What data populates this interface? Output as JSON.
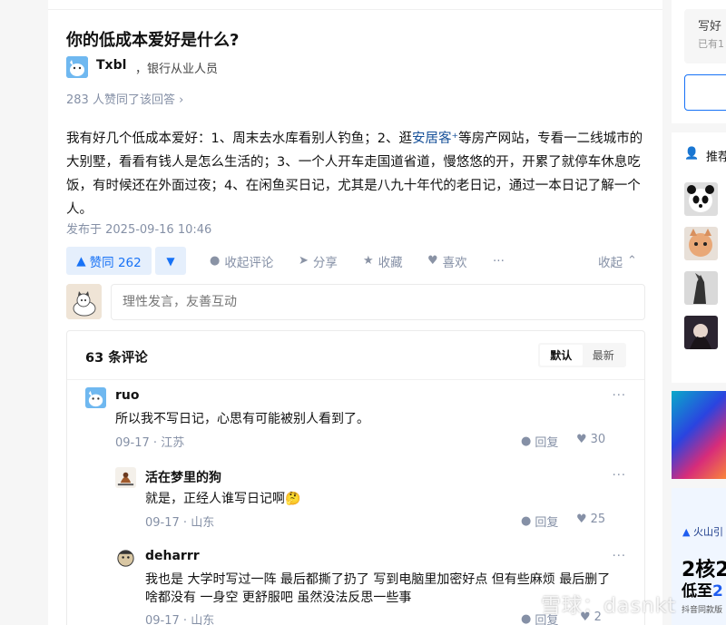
{
  "question": {
    "title": "你的低成本爱好是什么?"
  },
  "answer": {
    "author_name": "Txbl",
    "author_bio": "，银行从业人员",
    "upvote_summary": "283 人赞同了该回答 ›",
    "body_before_link": "我有好几个低成本爱好：1、周末去水库看别人钓鱼；2、逛",
    "body_link": "安居客",
    "body_after_link": "等房产网站，专看一二线城市的大别墅，看看有钱人是怎么生活的；3、一个人开车走国道省道，慢悠悠的开，开累了就停车休息吃饭，有时候还在外面过夜；4、在闲鱼买日记，尤其是八九十年代的老日记，通过一本日记了解一个人。",
    "post_time": "发布于 2025-09-16 10:46"
  },
  "actions": {
    "upvote_label": "赞同 262",
    "downvote_icon": "▼",
    "comment_label": "收起评论",
    "share_label": "分享",
    "favorite_label": "收藏",
    "like_label": "喜欢",
    "more_label": "···",
    "collapse_label": "收起"
  },
  "comment_input": {
    "placeholder": "理性发言，友善互动"
  },
  "comments": {
    "count_label": "63 条评论",
    "sort_tabs": [
      "默认",
      "最新"
    ],
    "items": [
      {
        "name": "ruo",
        "text": "所以我不写日记，心思有可能被别人看到了。",
        "date": "09-17",
        "location": "江苏",
        "reply_label": "回复",
        "likes": "30"
      },
      {
        "name": "活在梦里的狗",
        "text": "就是，正经人谁写日记啊🤔",
        "date": "09-17",
        "location": "山东",
        "reply_label": "回复",
        "likes": "25"
      },
      {
        "name": "deharrr",
        "text": "我也是 大学时写过一阵 最后都撕了扔了 写到电脑里加密好点 但有些麻烦 最后删了 啥都没有 一身空 更舒服吧 虽然没法反思一些事",
        "date": "09-17",
        "location": "山东",
        "reply_label": "回复",
        "likes": "2"
      }
    ]
  },
  "sidebar": {
    "write_title": "写好",
    "write_sub": "已有1",
    "recommend_title": "推荐",
    "ad_brand": "火山引",
    "ad_big": "2核2",
    "ad_mid_prefix": "低至",
    "ad_mid_highlight": "2",
    "ad_small": "抖音同款版"
  },
  "watermark": "雪球：dasnkt",
  "colors": {
    "brand_blue": "#1772f6",
    "muted": "#8590a6",
    "link": "#175199"
  }
}
